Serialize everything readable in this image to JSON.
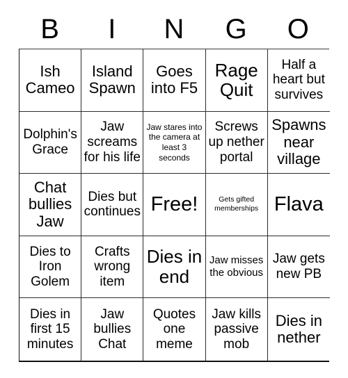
{
  "card": {
    "title": "BINGO",
    "columns": [
      "B",
      "I",
      "N",
      "G",
      "O"
    ],
    "free_space_index": 12,
    "colors": {
      "background": "#ffffff",
      "text": "#000000",
      "grid_line": "#2b2b2b",
      "outer_border": "#111111"
    },
    "cells": [
      {
        "text": "Ish Cameo",
        "size": "lg"
      },
      {
        "text": "Island Spawn",
        "size": "lg"
      },
      {
        "text": "Goes into F5",
        "size": "lg"
      },
      {
        "text": "Rage Quit",
        "size": "xl"
      },
      {
        "text": "Half a heart but survives",
        "size": "md"
      },
      {
        "text": "Dolphin's Grace",
        "size": "md"
      },
      {
        "text": "Jaw screams for his life",
        "size": "md"
      },
      {
        "text": "Jaw stares into the camera at least 3 seconds",
        "size": "xs"
      },
      {
        "text": "Screws up nether portal",
        "size": "md"
      },
      {
        "text": "Spawns near village",
        "size": "lg"
      },
      {
        "text": "Chat bullies Jaw",
        "size": "lg"
      },
      {
        "text": "Dies but continues",
        "size": "md"
      },
      {
        "text": "Free!",
        "size": "xxl"
      },
      {
        "text": "Gets gifted memberships",
        "size": "xxs"
      },
      {
        "text": "Flava",
        "size": "xxl"
      },
      {
        "text": "Dies to Iron Golem",
        "size": "md"
      },
      {
        "text": "Crafts wrong item",
        "size": "md"
      },
      {
        "text": "Dies in end",
        "size": "xl"
      },
      {
        "text": "Jaw misses the obvious",
        "size": "sm"
      },
      {
        "text": "Jaw gets new PB",
        "size": "md"
      },
      {
        "text": "Dies in first 15 minutes",
        "size": "md"
      },
      {
        "text": "Jaw bullies Chat",
        "size": "md"
      },
      {
        "text": "Quotes one meme",
        "size": "md"
      },
      {
        "text": "Jaw kills passive mob",
        "size": "md"
      },
      {
        "text": "Dies in nether",
        "size": "lg"
      }
    ]
  }
}
